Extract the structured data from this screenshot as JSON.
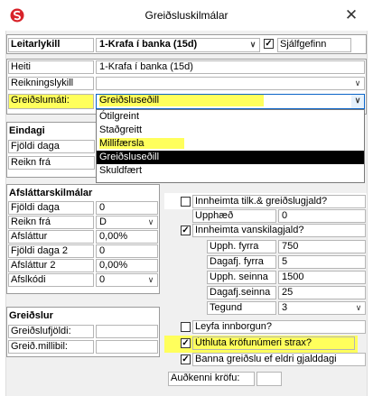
{
  "window": {
    "title": "Greiðsluskilmálar",
    "close_glyph": "✕"
  },
  "top": {
    "leitarlykill_label": "Leitarlykill",
    "leitarlykill_value": "1-Krafa í banka (15d)",
    "sjalfgefinn_label": "Sjálfgefinn",
    "sjalfgefinn_checked": true
  },
  "main": {
    "heiti_label": "Heiti",
    "heiti_value": "1-Krafa í banka (15d)",
    "reikningslykill_label": "Reikningslykill",
    "reikningslykill_value": "",
    "greidslumati_label": "Greiðslumáti:",
    "greidslumati_value": "Greiðsluseðill"
  },
  "dropdown": {
    "options": [
      "Ótilgreint",
      "Staðgreitt",
      "Millifærsla",
      "Greiðsluseðill",
      "Skuldfært"
    ]
  },
  "eindagi": {
    "header": "Eindagi",
    "fjoldi_daga_label": "Fjöldi daga",
    "reikn_fra_label": "Reikn frá"
  },
  "afslattur": {
    "header": "Afsláttarskilmálar",
    "rows": [
      {
        "label": "Fjöldi daga",
        "value": "0"
      },
      {
        "label": "Reikn frá",
        "value": "D"
      },
      {
        "label": "Afsláttur",
        "value": "0,00%"
      },
      {
        "label": "Fjöldi daga 2",
        "value": "0"
      },
      {
        "label": "Afsláttur 2",
        "value": "0,00%"
      },
      {
        "label": "Afslkódi",
        "value": "0"
      }
    ]
  },
  "greidslur": {
    "header": "Greiðslur",
    "greidslufjoldi_label": "Greiðslufjöldi:",
    "greidslufjoldi_value": "",
    "millibil_label": "Greið.millibil:",
    "millibil_value": ""
  },
  "right": {
    "innheimta_tilk_label": "Innheimta tilk.& greiðslugjald?",
    "innheimta_tilk_checked": false,
    "upphaed_label": "Upphæð",
    "upphaed_value": "0",
    "innheimta_vanskila_label": "Innheimta vanskilagjald?",
    "innheimta_vanskila_checked": true,
    "vanskila_rows": [
      {
        "label": "Upph. fyrra",
        "value": "750"
      },
      {
        "label": "Dagafj. fyrra",
        "value": "5"
      },
      {
        "label": "Upph. seinna",
        "value": "1500"
      },
      {
        "label": "Dagafj.seinna",
        "value": "25"
      },
      {
        "label": "Tegund",
        "value": "3"
      }
    ],
    "leyfa_label": "Leyfa innborgun?",
    "leyfa_checked": false,
    "uthluta_label": "Úthluta kröfunúmeri strax?",
    "uthluta_checked": true,
    "banna_label": "Banna greiðslu ef eldri gjalddagi",
    "banna_checked": true,
    "audkenni_label": "Auðkenni kröfu:",
    "audkenni_value": ""
  },
  "colors": {
    "highlight": "#ffff5c",
    "selected": "#000000",
    "accent": "#0a64c8"
  }
}
